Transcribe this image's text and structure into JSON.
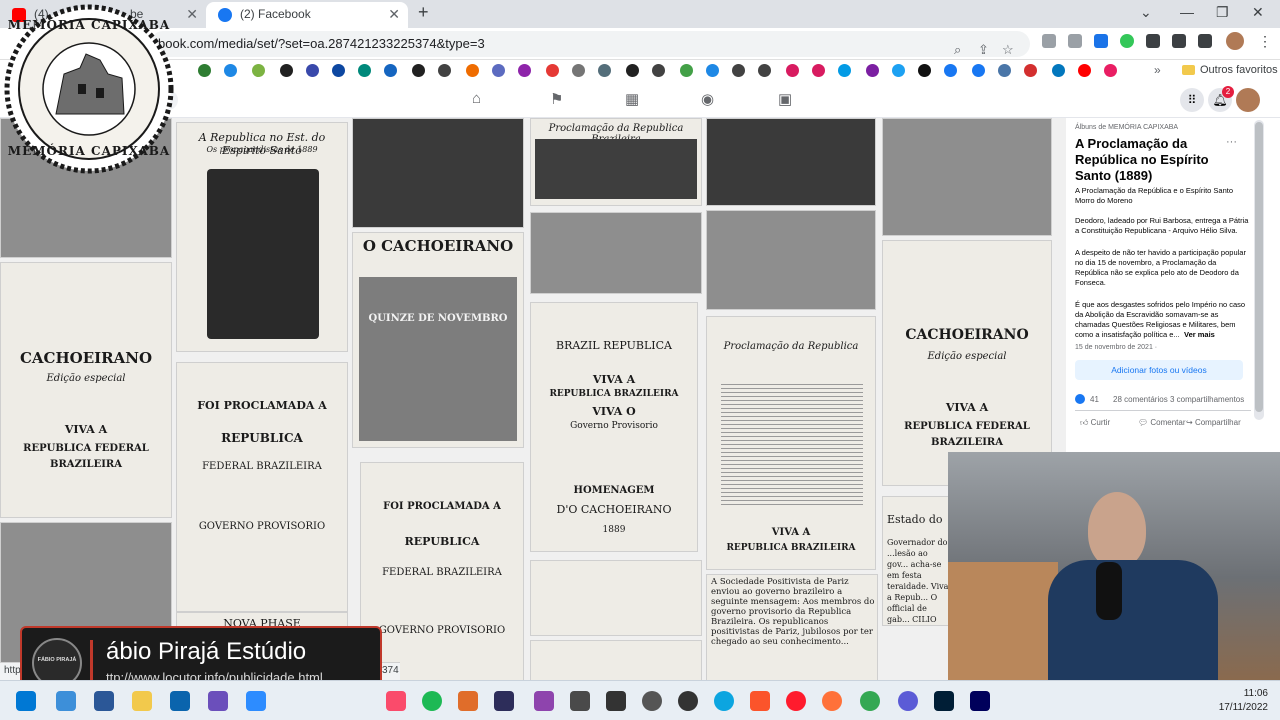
{
  "browser": {
    "tabs": [
      {
        "label": "(4)",
        "label_tail": "be",
        "active": false,
        "favicon_color": "#ff0000"
      },
      {
        "label": "(2) Facebook",
        "active": true,
        "favicon_color": "#1877f2"
      }
    ],
    "new_tab_glyph": "+",
    "window_controls": [
      "⌄",
      "—",
      "❐",
      "✕"
    ],
    "address": "book.com/media/set/?set=oa.287421233225374&type=3",
    "bookmarks_folder": "Outros favoritos",
    "status_url_fragment": "374",
    "status_url_prefix": "http"
  },
  "facebook": {
    "nav_icons": [
      "home-icon",
      "flag-icon",
      "marketplace-icon",
      "groups-icon",
      "gaming-icon"
    ],
    "notification_count": "2",
    "album_label": "Álbuns de MEMÓRIA CAPIXABA",
    "title": "A Proclamação da República no Espírito Santo (1889)",
    "subtitle": "A Proclamação da República e o Espírito Santo Morro do Moreno",
    "paragraph1": "Deodoro, ladeado por Rui Barbosa, entrega a Pátria a Constituição Republicana - Arquivo Hélio Silva.",
    "paragraph2": "A despeito de não ter havido a participação popular no dia 15 de novembro, a Proclamação da República não se explica pelo ato de Deodoro da Fonseca.",
    "paragraph3": "É que aos desgastes sofridos pelo Império no caso da Abolição da Escravidão somavam-se as chamadas Questões Religiosas e Militares, bem como a insatisfação política e...",
    "see_more": "Ver mais",
    "date": "15 de novembro de 2021 · ",
    "add_button": "Adicionar fotos ou vídeos",
    "reactions": "41",
    "comments": "28 comentários",
    "shares": "3 compartilhamentos",
    "like": "Curtir",
    "comment": "Comentar",
    "share": "Compartilhar",
    "more": "···"
  },
  "clippings": {
    "c1": "A Republica no Est. do Espirito Santo",
    "c1b": "Os propagandistas de 1889",
    "c2": "O CACHOEIRANO",
    "c2b": "QUINZE DE NOVEMBRO",
    "c3": "Proclamação da Republica Brazileira",
    "c4": "CACHOEIRANO",
    "c4b": "Edição especial",
    "c4c": "VIVA A",
    "c4d": "REPUBLICA FEDERAL",
    "c4e": "BRAZILEIRA",
    "c5": "FOI PROCLAMADA A",
    "c5b": "REPUBLICA",
    "c5c": "FEDERAL BRAZILEIRA",
    "c5d": "GOVERNO PROVISORIO",
    "c6": "BRAZIL REPUBLICA",
    "c6b": "VIVA A",
    "c6c": "REPUBLICA BRAZILEIRA",
    "c6d": "VIVA O",
    "c6e": "Governo Provisorio",
    "c6f": "HOMENAGEM",
    "c6g": "D'O CACHOEIRANO",
    "c6h": "1889",
    "c7": "Proclamação da Republica",
    "c7b": "VIVA A",
    "c7c": "REPUBLICA BRAZILEIRA",
    "c8": "CACHOEIRANO",
    "c8b": "Edição especial",
    "c8c": "VIVA A",
    "c8d": "REPUBLICA FEDERAL",
    "c8e": "BRAZILEIRA",
    "c9": "FOI PROCLAMADA A",
    "c9b": "REPUBLICA",
    "c9c": "FEDERAL BRAZILEIRA",
    "c9d": "GOVERNO PROVISORIO",
    "c10": "NOVA PHASE",
    "c11": "A Sociedade Positivista de Pariz enviou ao governo brazileiro a seguinte mensagem: Aos membros do governo provisorio da Republica Brazileira. Os republicanos positivistas de Pariz, jubilosos por ter chegado ao seu conhecimento...",
    "c12": "Estado do",
    "c12b": "Governador do ...lesão ao gov... acha-se em festa teraidade. Viva a Repub... O official de gab... CILIO DA SILVA"
  },
  "overlay": {
    "badge_text_top": "MEMÓRIA CAPIXABA",
    "badge_text_bottom": "MEMÓRIA CAPIXABA",
    "lower_third_name": "ábio Pirajá Estúdio",
    "lower_third_url": "ttp://www.locutor.info/publicidade.html",
    "lower_third_logo": "FÁBIO PIRAJÁ"
  },
  "taskbar": {
    "time": "11:06",
    "date": "17/11/2022",
    "apps": [
      "windows-icon",
      "explorer-icon",
      "calendar-icon",
      "folder-icon",
      "mail-icon",
      "media-icon",
      "zoom-icon",
      "itunes-icon",
      "spotify-icon",
      "winamp-icon",
      "premiere-icon",
      "tool-icon",
      "davinci-icon",
      "obs-icon",
      "edge-icon",
      "brave-icon",
      "opera-icon",
      "firefox-icon",
      "chrome-icon",
      "vegas-icon",
      "photoshop-icon",
      "audition-icon"
    ]
  },
  "colors": {
    "fb_blue": "#1877f2",
    "chrome_tab": "#dee1e6",
    "accent_red": "#c0392b",
    "badge_red": "#e41e3f"
  }
}
